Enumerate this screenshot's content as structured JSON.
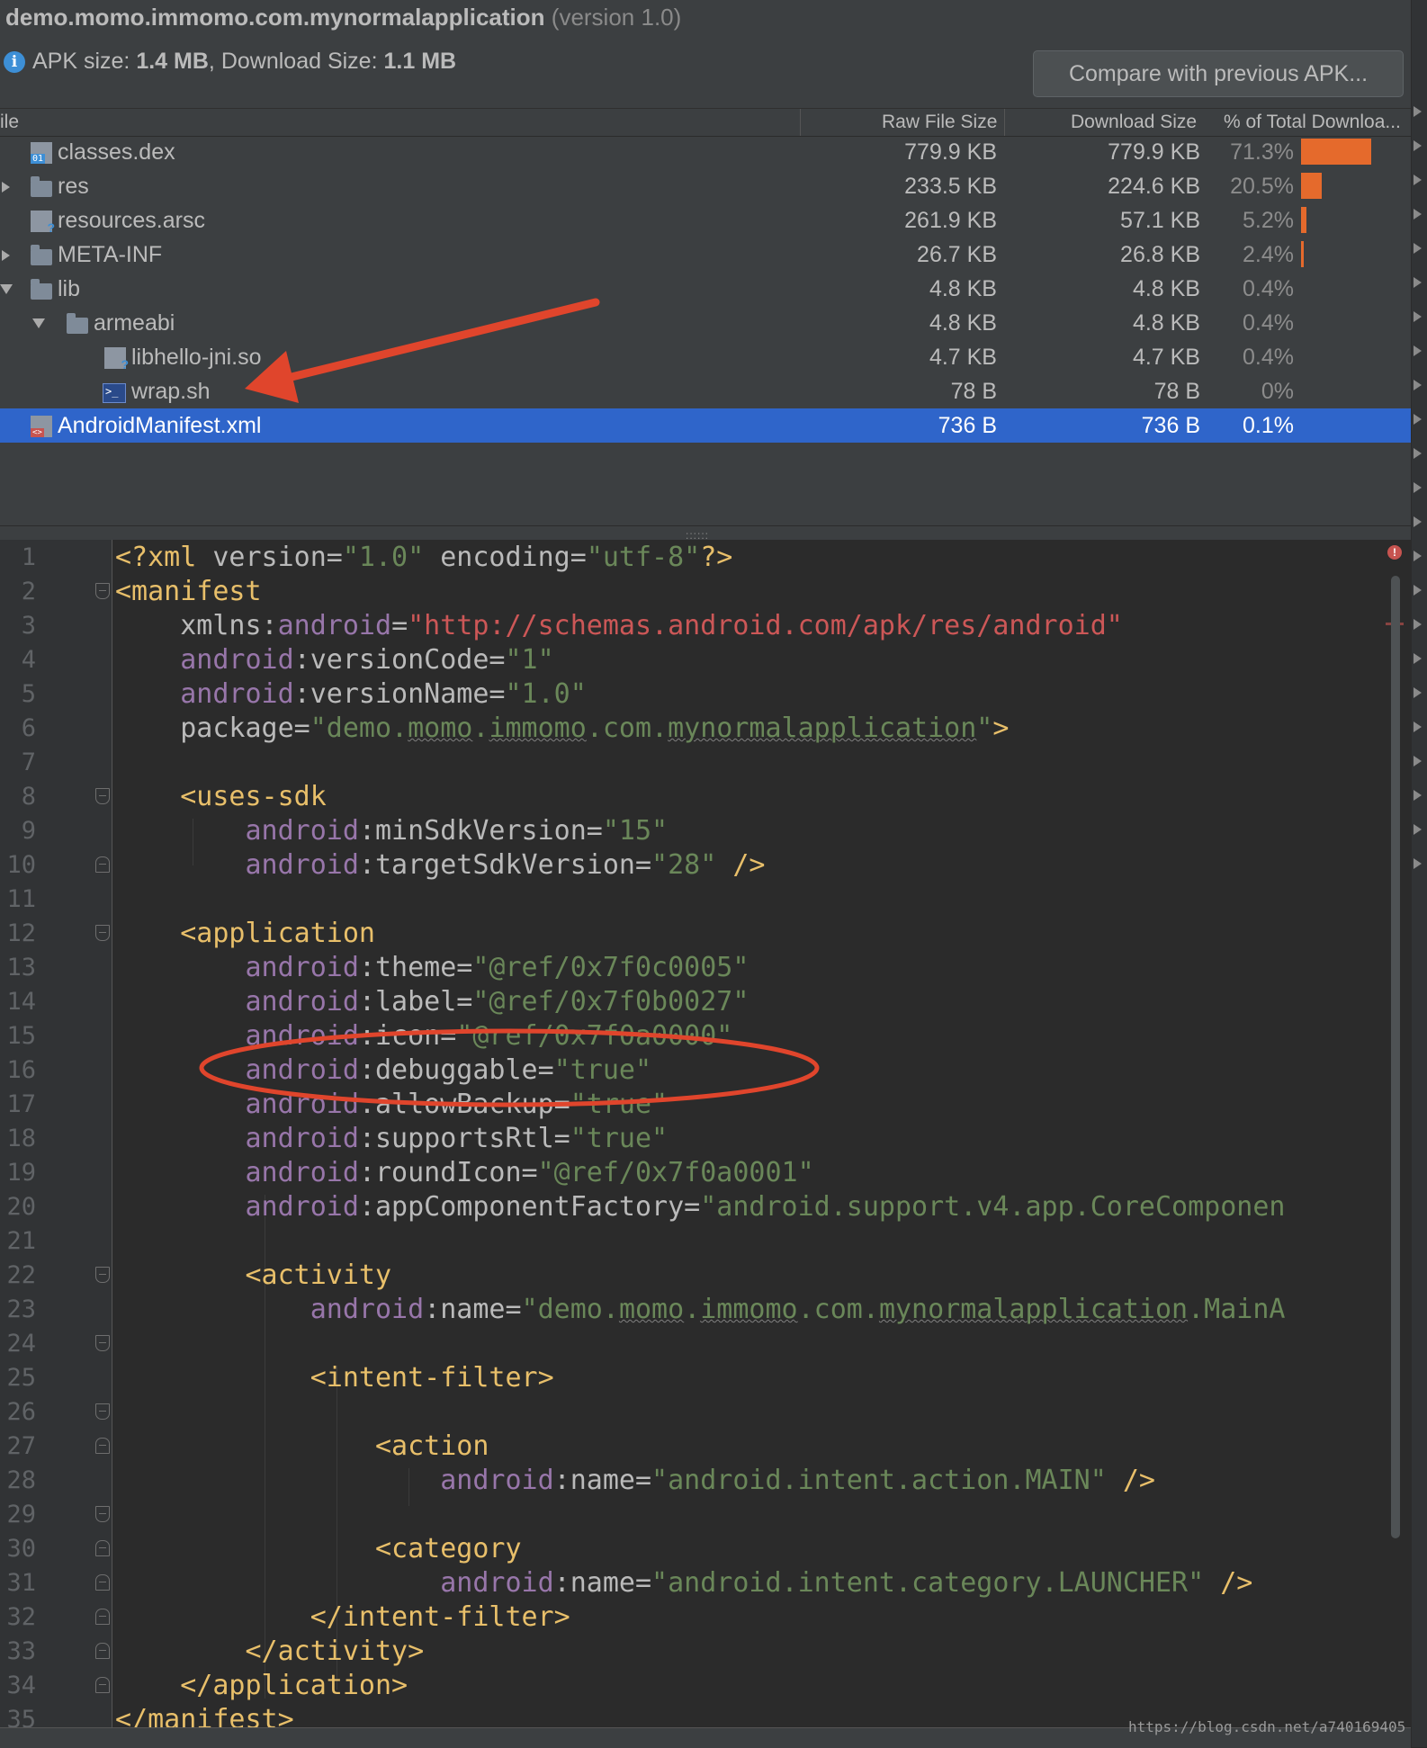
{
  "header": {
    "package_name": "demo.momo.immomo.com.mynormalapplication",
    "version_text": "(version 1.0)",
    "apk_size_label": "APK size:",
    "apk_size_value": "1.4 MB",
    "download_size_label": "Download Size:",
    "download_size_value": "1.1 MB",
    "compare_button": "Compare with previous APK..."
  },
  "columns": {
    "file": "ile",
    "raw": "Raw File Size",
    "download": "Download Size",
    "percent": "% of Total Downloa..."
  },
  "rows": [
    {
      "name": "classes.dex",
      "raw": "779.9 KB",
      "download": "779.9 KB",
      "percent": "71.3%",
      "fraction": 0.713,
      "icon": "dex-file-icon"
    },
    {
      "name": "res",
      "raw": "233.5 KB",
      "download": "224.6 KB",
      "percent": "20.5%",
      "fraction": 0.205,
      "icon": "folder-icon"
    },
    {
      "name": "resources.arsc",
      "raw": "261.9 KB",
      "download": "57.1 KB",
      "percent": "5.2%",
      "fraction": 0.052,
      "icon": "arsc-file-icon"
    },
    {
      "name": "META-INF",
      "raw": "26.7 KB",
      "download": "26.8 KB",
      "percent": "2.4%",
      "fraction": 0.024,
      "icon": "folder-icon"
    },
    {
      "name": "lib",
      "raw": "4.8 KB",
      "download": "4.8 KB",
      "percent": "0.4%",
      "fraction": 0.004,
      "icon": "folder-icon"
    },
    {
      "name": "armeabi",
      "raw": "4.8 KB",
      "download": "4.8 KB",
      "percent": "0.4%",
      "fraction": 0.004,
      "icon": "folder-icon"
    },
    {
      "name": "libhello-jni.so",
      "raw": "4.7 KB",
      "download": "4.7 KB",
      "percent": "0.4%",
      "fraction": 0.004,
      "icon": "so-file-icon"
    },
    {
      "name": "wrap.sh",
      "raw": "78 B",
      "download": "78 B",
      "percent": "0%",
      "fraction": 0.0,
      "icon": "shell-script-icon"
    },
    {
      "name": "AndroidManifest.xml",
      "raw": "736 B",
      "download": "736 B",
      "percent": "0.1%",
      "fraction": 0.001,
      "icon": "xml-file-icon",
      "selected": true
    }
  ],
  "editor": {
    "line_numbers": [
      "1",
      "2",
      "3",
      "4",
      "5",
      "6",
      "7",
      "8",
      "9",
      "10",
      "11",
      "12",
      "13",
      "14",
      "15",
      "16",
      "17",
      "18",
      "19",
      "20",
      "21",
      "22",
      "23",
      "24",
      "25",
      "26",
      "27",
      "28",
      "29",
      "30",
      "31",
      "32",
      "33",
      "34",
      "35"
    ],
    "code": {
      "l1": {
        "a": "<?xml ",
        "b": "version=",
        "c": "\"1.0\"",
        "d": " encoding=",
        "e": "\"utf-8\"",
        "f": "?>"
      },
      "l2": {
        "a": "<manifest"
      },
      "l3": {
        "a": "xmlns:",
        "b": "android",
        "c": "=",
        "d": "\"http://schemas.android.com/apk/res/android\""
      },
      "l4": {
        "a": "android",
        "b": ":versionCode=",
        "c": "\"1\""
      },
      "l5": {
        "a": "android",
        "b": ":versionName=",
        "c": "\"1.0\""
      },
      "l6": {
        "a": "package=",
        "b": "\"demo.",
        "c": "momo",
        "d": ".",
        "e": "immomo",
        "f": ".com.",
        "g": "mynormalapplication",
        "h": "\"",
        "i": ">"
      },
      "l8": {
        "a": "<uses-sdk"
      },
      "l9": {
        "a": "android",
        "b": ":minSdkVersion=",
        "c": "\"15\""
      },
      "l10": {
        "a": "android",
        "b": ":targetSdkVersion=",
        "c": "\"28\"",
        "d": " />"
      },
      "l12": {
        "a": "<application"
      },
      "l13": {
        "a": "android",
        "b": ":theme=",
        "c": "\"@ref/0x7f0c0005\""
      },
      "l14": {
        "a": "android",
        "b": ":label=",
        "c": "\"@ref/0x7f0b0027\""
      },
      "l15": {
        "a": "android",
        "b": ":icon=",
        "c": "\"@ref/0x7f0a0000\""
      },
      "l16": {
        "a": "android",
        "b": ":debuggable=",
        "c": "\"true\""
      },
      "l17": {
        "a": "android",
        "b": ":allowBackup=",
        "c": "\"true\""
      },
      "l18": {
        "a": "android",
        "b": ":supportsRtl=",
        "c": "\"true\""
      },
      "l19": {
        "a": "android",
        "b": ":roundIcon=",
        "c": "\"@ref/0x7f0a0001\""
      },
      "l20": {
        "a": "android",
        "b": ":appComponentFactory=",
        "c": "\"android.support.v4.app.CoreComponen"
      },
      "l22": {
        "a": "<activity"
      },
      "l23": {
        "a": "android",
        "b": ":name=",
        "c": "\"demo.",
        "d": "momo",
        "e": ".",
        "f": "immomo",
        "g": ".com.",
        "h": "mynormalapplication",
        "i": ".MainA"
      },
      "l25": {
        "a": "<intent-filter>"
      },
      "l27": {
        "a": "<action"
      },
      "l28": {
        "a": "android",
        "b": ":name=",
        "c": "\"android.intent.action.MAIN\"",
        "d": " />"
      },
      "l30": {
        "a": "<category"
      },
      "l31": {
        "a": "android",
        "b": ":name=",
        "c": "\"android.intent.category.LAUNCHER\"",
        "d": " />"
      },
      "l32": {
        "a": "</intent-filter>"
      },
      "l33": {
        "a": "</activity>"
      },
      "l34": {
        "a": "</application>"
      },
      "l35": {
        "a": "</manifest>"
      }
    }
  },
  "watermark": "https://blog.csdn.net/a740169405",
  "colors": {
    "selection": "#2f65ca",
    "size_bar": "#e56a2c",
    "annotation_red": "#e0452c",
    "xml_tag": "#e8bf6a",
    "xml_namespace": "#9876aa",
    "xml_string": "#6a8759",
    "xml_url": "#cc5757"
  }
}
